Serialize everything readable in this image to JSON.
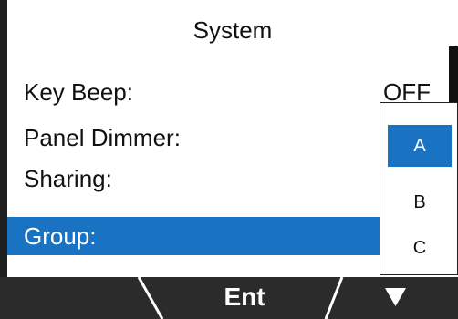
{
  "screen": {
    "title": "System",
    "rows": [
      {
        "label": "Key Beep:",
        "value": "OFF"
      },
      {
        "label": "Panel Dimmer:",
        "value": ""
      },
      {
        "label": "Sharing:",
        "value": ""
      },
      {
        "label": "Group:",
        "value": "",
        "selected": true
      }
    ]
  },
  "popup": {
    "options": [
      "A",
      "B",
      "C"
    ],
    "selected": "A"
  },
  "softkeys": {
    "left": "",
    "center": "Ent",
    "right_icon": "down-triangle-icon"
  },
  "colors": {
    "highlight": "#1a73c2",
    "softkey_bar": "#2b2b2b"
  }
}
